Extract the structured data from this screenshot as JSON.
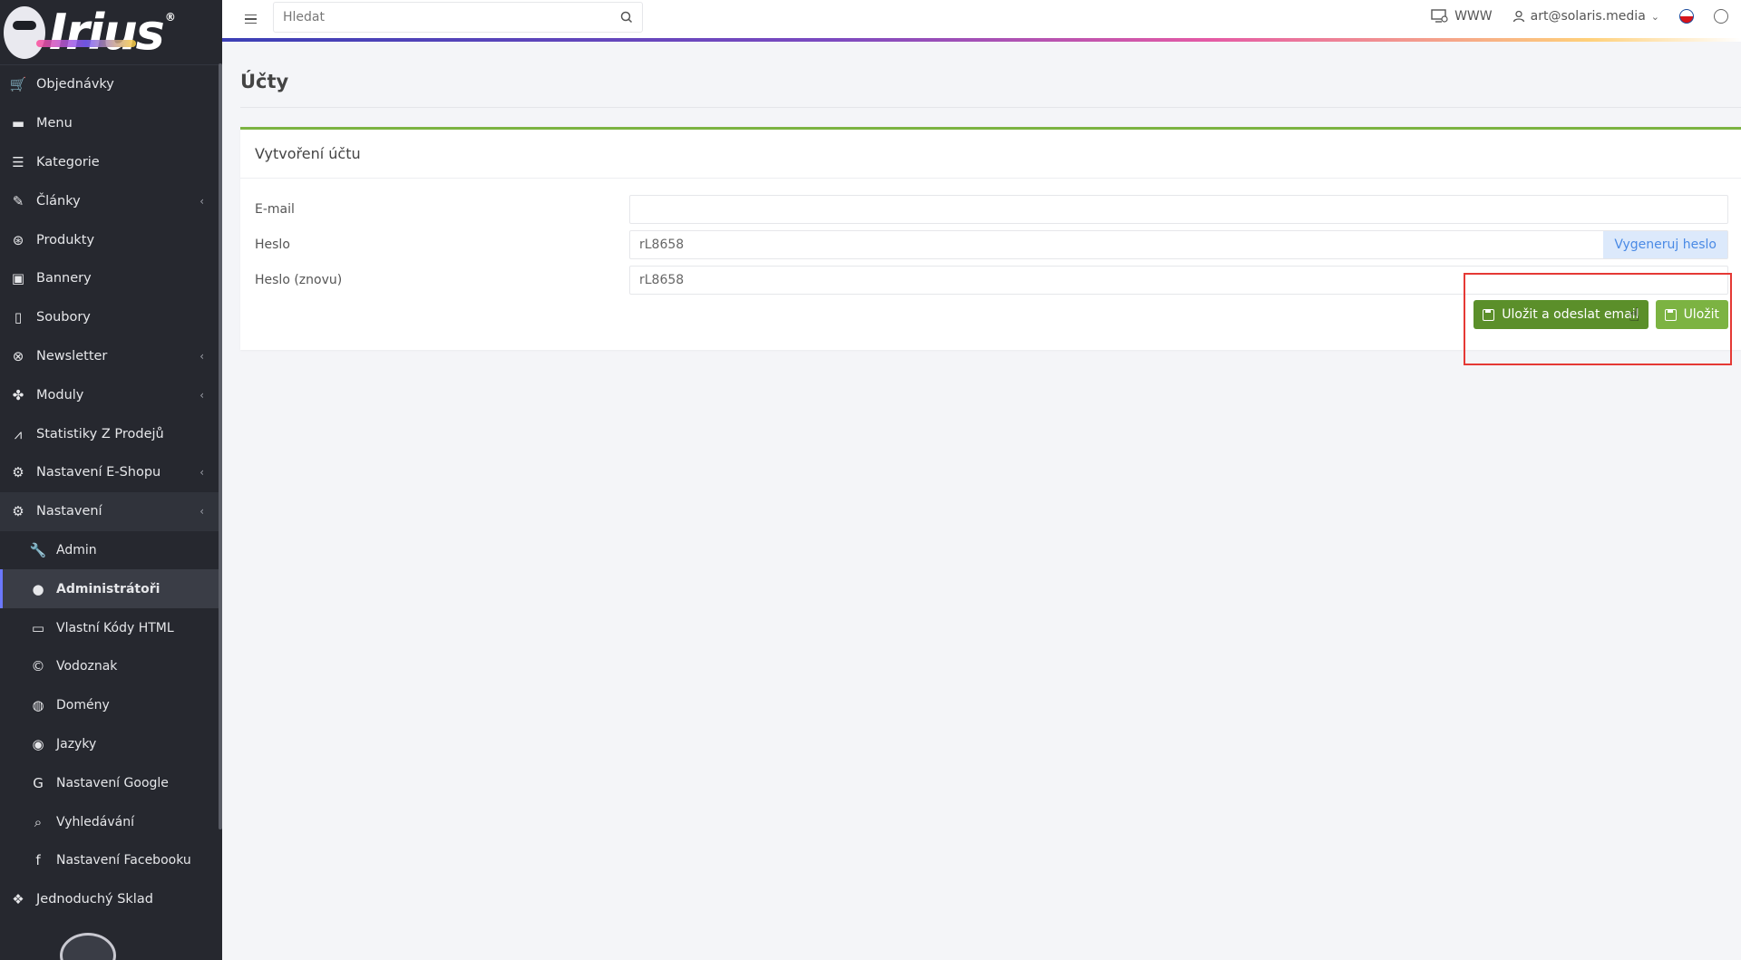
{
  "sidebar": {
    "logo": "Irius",
    "items": [
      {
        "label": "Objednávky",
        "icon": "cart-icon"
      },
      {
        "label": "Menu",
        "icon": "folder-icon"
      },
      {
        "label": "Kategorie",
        "icon": "list-icon"
      },
      {
        "label": "Články",
        "icon": "pencil-icon",
        "chevron": true
      },
      {
        "label": "Produkty",
        "icon": "product-icon"
      },
      {
        "label": "Bannery",
        "icon": "image-icon"
      },
      {
        "label": "Soubory",
        "icon": "file-icon"
      },
      {
        "label": "Newsletter",
        "icon": "newsletter-icon",
        "chevron": true
      },
      {
        "label": "Moduly",
        "icon": "puzzle-icon",
        "chevron": true
      },
      {
        "label": "Statistiky Z Prodejů",
        "icon": "chart-icon"
      },
      {
        "label": "Nastavení E-Shopu",
        "icon": "cogs-icon",
        "chevron": true
      },
      {
        "label": "Nastavení",
        "icon": "cogs-icon",
        "chevron": true,
        "open": true
      }
    ],
    "sub_items": [
      {
        "label": "Admin",
        "icon": "wrench-icon"
      },
      {
        "label": "Administrátoři",
        "icon": "user-icon",
        "active": true
      },
      {
        "label": "Vlastní Kódy HTML",
        "icon": "html-icon"
      },
      {
        "label": "Vodoznak",
        "icon": "copyright-icon"
      },
      {
        "label": "Domény",
        "icon": "globe-icon"
      },
      {
        "label": "Jazyky",
        "icon": "language-globe-icon"
      },
      {
        "label": "Nastavení Google",
        "icon": "google-icon"
      },
      {
        "label": "Vyhledávání",
        "icon": "search-icon"
      },
      {
        "label": "Nastavení Facebooku",
        "icon": "facebook-icon"
      }
    ],
    "last_item": {
      "label": "Jednoduchý Sklad",
      "icon": "dropbox-icon"
    }
  },
  "topbar": {
    "search_placeholder": "Hledat",
    "www_label": "WWW",
    "user_email": "art@solaris.media"
  },
  "main": {
    "page_title": "Účty",
    "card_title": "Vytvoření účtu",
    "fields": {
      "email_label": "E-mail",
      "email_value": "",
      "password_label": "Heslo",
      "password_value": "rL8658",
      "password_repeat_label": "Heslo (znovu)",
      "password_repeat_value": "rL8658"
    },
    "generate_button": "Vygeneruj heslo",
    "save_and_send_button": "Uložit a odeslat email",
    "save_button": "Uložit"
  },
  "colors": {
    "sidebar_bg": "#26282f",
    "card_accent": "#7cb342",
    "save_send_bg": "#5b8f2a",
    "save_bg": "#7cb342",
    "generate_text": "#4a8ae5",
    "highlight_box": "#e53935"
  }
}
